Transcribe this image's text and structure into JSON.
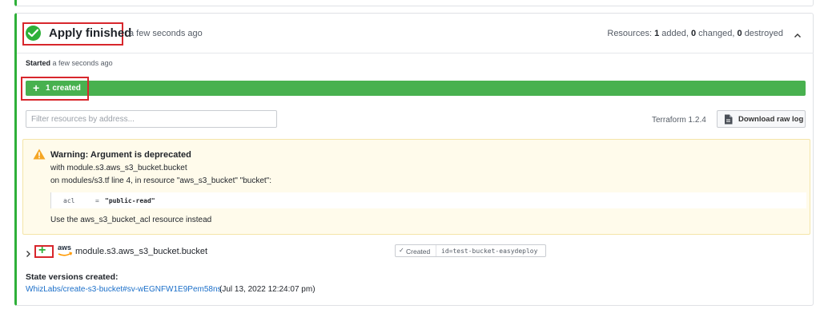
{
  "run": {
    "status_title": "Apply finished",
    "status_time": "a few seconds ago",
    "resources_prefix": "Resources:",
    "resources_added": "1",
    "resources_added_label": "added,",
    "resources_changed": "0",
    "resources_changed_label": "changed,",
    "resources_destroyed": "0",
    "resources_destroyed_label": "destroyed",
    "started_label": "Started",
    "started_time": "a few seconds ago",
    "created_summary": "1 created"
  },
  "toolbar": {
    "filter_placeholder": "Filter resources by address...",
    "terraform_version": "Terraform 1.2.4",
    "download_label": "Download raw log"
  },
  "warning": {
    "title": "Warning: Argument is deprecated",
    "line1": "with module.s3.aws_s3_bucket.bucket",
    "line2": "on modules/s3.tf line 4, in resource \"aws_s3_bucket\" \"bucket\":",
    "code_key": "acl",
    "code_eq": "=",
    "code_value": "\"public-read\"",
    "advice": "Use the aws_s3_bucket_acl resource instead"
  },
  "resource": {
    "provider_logo_text": "aws",
    "address": "module.s3.aws_s3_bucket.bucket",
    "status": "Created",
    "id": "id=test-bucket-easydeploy"
  },
  "state_versions": {
    "title": "State versions created:",
    "link_text": "WhizLabs/create-s3-bucket#sv-wEGNFW1E9Pem58ns",
    "date": "(Jul 13, 2022 12:24:07 pm)"
  },
  "colors": {
    "success_green": "#2eb039",
    "created_bar": "#48b14f",
    "highlight_red": "#d8262c",
    "warning_bg": "#fffbeb",
    "warning_icon": "#f5a623",
    "link_blue": "#1b6fc9"
  },
  "icons": [
    "check-circle-icon",
    "chevron-up-icon",
    "plus-icon",
    "document-icon",
    "warning-triangle-icon",
    "chevron-right-icon",
    "aws-logo-icon",
    "checkmark-icon"
  ]
}
